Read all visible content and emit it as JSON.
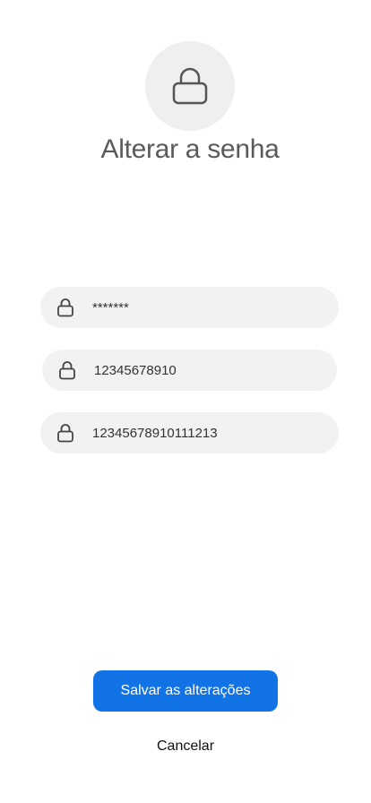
{
  "header": {
    "icon": "lock-icon",
    "title": "Alterar a senha"
  },
  "form": {
    "current_password": {
      "icon": "lock-icon",
      "value": "*******"
    },
    "new_password": {
      "icon": "lock-icon",
      "value": "12345678910"
    },
    "confirm_password": {
      "icon": "lock-icon",
      "value": "12345678910111213"
    }
  },
  "actions": {
    "save_label": "Salvar as alterações",
    "cancel_label": "Cancelar"
  },
  "colors": {
    "accent": "#1273e6",
    "field_background": "#f2f2f2",
    "icon_circle": "#efefef",
    "title_text": "#5a5a5a"
  }
}
